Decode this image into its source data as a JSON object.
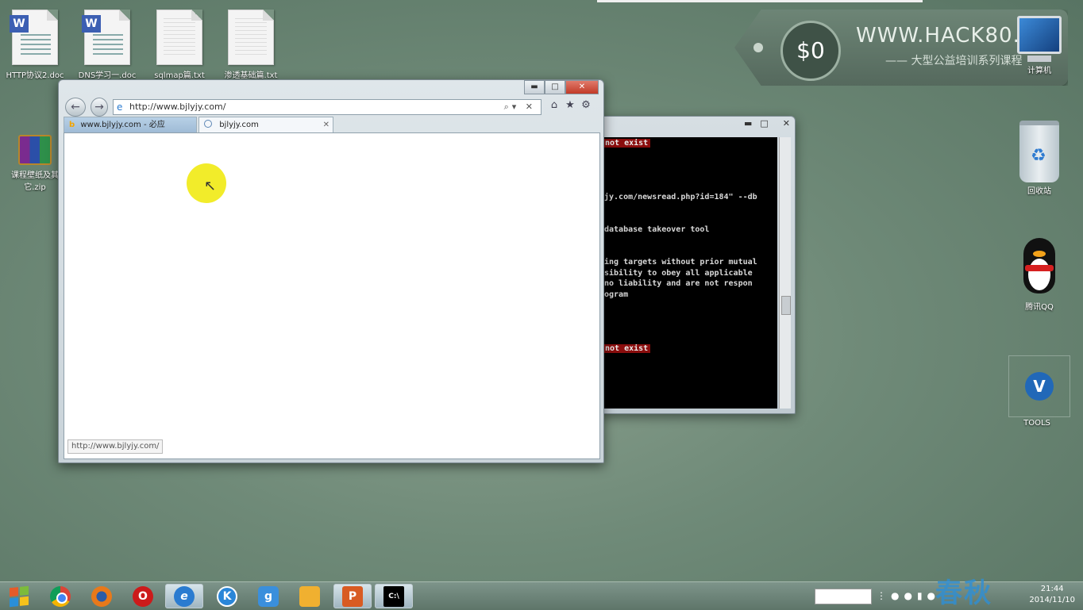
{
  "desktop_icons_left": [
    {
      "label": "HTTP协议2.doc",
      "type": "word"
    },
    {
      "label": "DNS学习一.doc",
      "type": "word"
    },
    {
      "label": "sqlmap篇.txt",
      "type": "text"
    },
    {
      "label": "渗透基础篇.txt",
      "type": "text"
    },
    {
      "label": "课程壁纸及其它.zip",
      "type": "archive"
    }
  ],
  "banner": {
    "price": "$0",
    "site": "WWW.HACK80.C",
    "subtitle": "—— 大型公益培训系列课程"
  },
  "desktop_icons_right": [
    {
      "label": "计算机",
      "icon": "computer-icon"
    },
    {
      "label": "回收站",
      "icon": "recycle-bin-icon"
    },
    {
      "label": "腾讯QQ",
      "icon": "qq-penguin-icon"
    },
    {
      "label": "TOOLS",
      "icon": "tools-icon"
    }
  ],
  "ie": {
    "window_controls": {
      "minimize": "▬",
      "maximize": "□",
      "close": "✕"
    },
    "address": "http://www.bjlyjy.com/",
    "tabs": [
      {
        "label": "www.bjlyjy.com - 必应"
      },
      {
        "label": "bjlyjy.com"
      }
    ],
    "status_url": "http://www.bjlyjy.com/"
  },
  "cmd": {
    "controls": {
      "minimize": "▬",
      "maximize": "□",
      "close": "✕"
    },
    "lines": [
      {
        "text": "not exist",
        "err": true
      },
      {
        "text": "jy.com/newsread.php?id=184\" --db",
        "err": false
      },
      {
        "text": "database takeover tool",
        "err": false
      },
      {
        "text": "ing targets without prior mutual",
        "err": false
      },
      {
        "text": "sibility to obey all applicable",
        "err": false
      },
      {
        "text": "no liability and are not respon",
        "err": false
      },
      {
        "text": "ogram",
        "err": false
      },
      {
        "text": "not exist",
        "err": true
      }
    ]
  },
  "taskbar": {
    "start_icon": "windows-start-icon",
    "apps": [
      {
        "name": "chrome",
        "color": "#d94a38"
      },
      {
        "name": "firefox",
        "color": "#e8791b"
      },
      {
        "name": "opera",
        "color": "#cc1b1b"
      },
      {
        "name": "ie",
        "color": "#2a7bd0"
      },
      {
        "name": "kugou",
        "color": "#2a86d8"
      },
      {
        "name": "baidu-im",
        "color": "#3a8fdc"
      },
      {
        "name": "explorer",
        "color": "#f0b030"
      },
      {
        "name": "powerpoint",
        "color": "#d85b22"
      },
      {
        "name": "cmd",
        "color": "#000000"
      }
    ],
    "clock_time": "21:44",
    "clock_date": "2014/11/10"
  },
  "watermark": "春秋"
}
